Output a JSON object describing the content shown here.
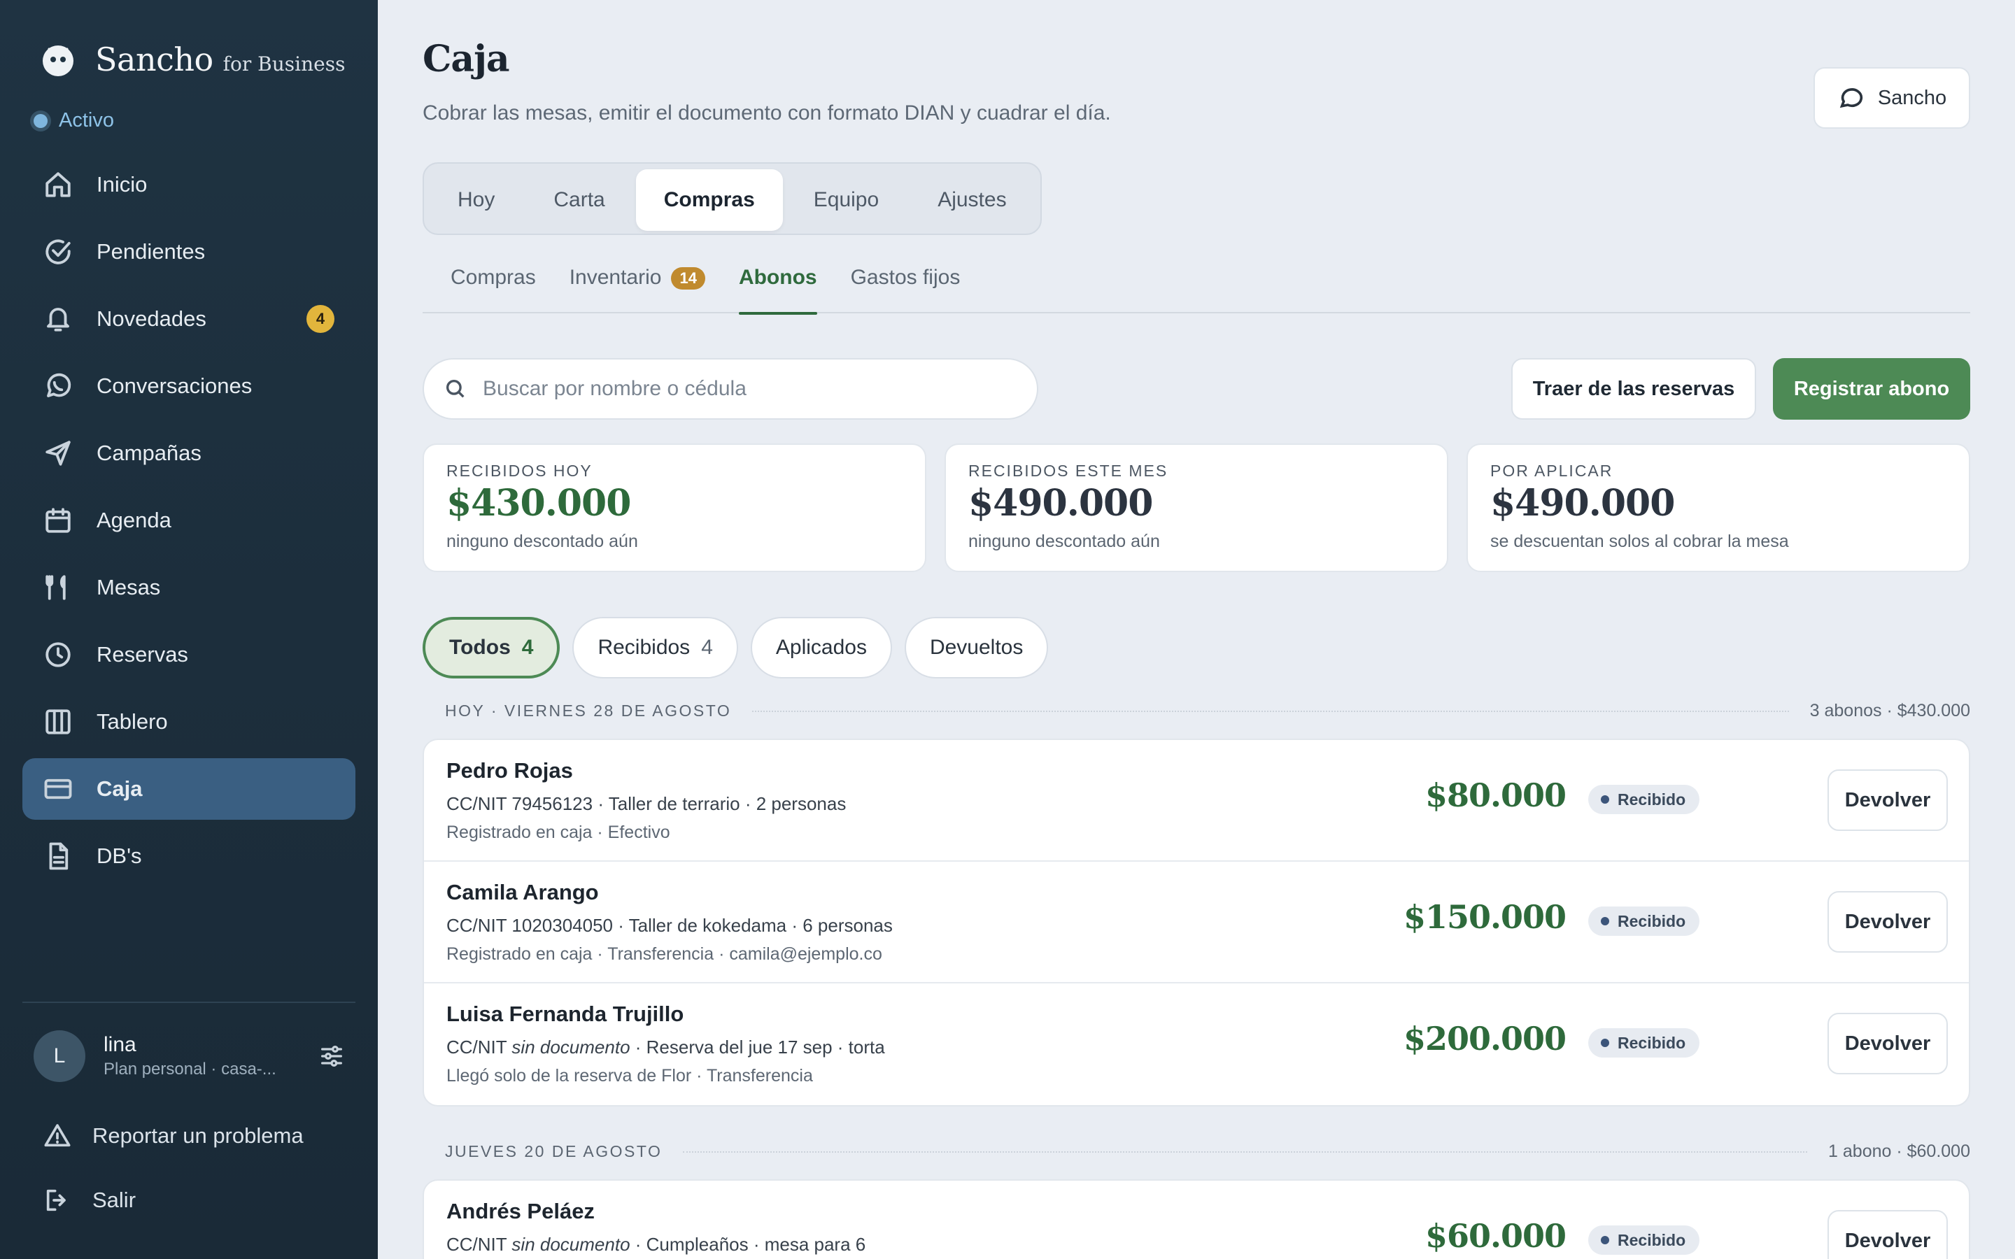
{
  "brand": {
    "name": "Sancho",
    "suffix": "for Business"
  },
  "status": {
    "label": "Activo"
  },
  "nav": [
    {
      "label": "Inicio",
      "icon": "home-icon"
    },
    {
      "label": "Pendientes",
      "icon": "check-circle-icon"
    },
    {
      "label": "Novedades",
      "icon": "bell-icon",
      "badge": "4"
    },
    {
      "label": "Conversaciones",
      "icon": "whatsapp-icon"
    },
    {
      "label": "Campañas",
      "icon": "send-icon"
    },
    {
      "label": "Agenda",
      "icon": "calendar-icon"
    },
    {
      "label": "Mesas",
      "icon": "utensils-icon"
    },
    {
      "label": "Reservas",
      "icon": "clock-icon"
    },
    {
      "label": "Tablero",
      "icon": "columns-icon"
    },
    {
      "label": "Caja",
      "icon": "credit-card-icon",
      "active": true
    },
    {
      "label": "DB's",
      "icon": "document-icon"
    }
  ],
  "user": {
    "initial": "L",
    "name": "lina",
    "plan": "Plan personal · casa-..."
  },
  "footer_links": {
    "report": "Reportar un problema",
    "logout": "Salir"
  },
  "page": {
    "title": "Caja",
    "subtitle": "Cobrar las mesas, emitir el documento con formato DIAN y cuadrar el día.",
    "assistant_button": "Sancho"
  },
  "segments": [
    "Hoy",
    "Carta",
    "Compras",
    "Equipo",
    "Ajustes"
  ],
  "segment_active": "Compras",
  "subtabs": {
    "compras": "Compras",
    "inventario": "Inventario",
    "inventario_badge": "14",
    "abonos": "Abonos",
    "gastos": "Gastos fijos"
  },
  "search": {
    "placeholder": "Buscar por nombre o cédula",
    "value": ""
  },
  "actions": {
    "secondary": "Traer de las reservas",
    "primary": "Registrar abono"
  },
  "stats": [
    {
      "label": "RECIBIDOS HOY",
      "value": "$430.000",
      "note": "ninguno descontado aún"
    },
    {
      "label": "RECIBIDOS ESTE MES",
      "value": "$490.000",
      "note": "ninguno descontado aún"
    },
    {
      "label": "POR APLICAR",
      "value": "$490.000",
      "note": "se descuentan solos al cobrar la mesa"
    }
  ],
  "filters": [
    {
      "label": "Todos",
      "count": "4",
      "active": true
    },
    {
      "label": "Recibidos",
      "count": "4"
    },
    {
      "label": "Aplicados",
      "count": ""
    },
    {
      "label": "Devueltos",
      "count": ""
    }
  ],
  "groups": [
    {
      "label": "HOY · VIERNES 28 DE AGOSTO",
      "summary": "3 abonos · $430.000",
      "rows": [
        {
          "name": "Pedro Rojas",
          "doc": "79456123",
          "doc_missing": false,
          "details": " · Taller de terrario · 2 personas",
          "sub": "Registrado en caja · Efectivo",
          "amount": "$80.000",
          "status": "Recibido",
          "action": "Devolver"
        },
        {
          "name": "Camila Arango",
          "doc": "1020304050",
          "doc_missing": false,
          "details": " · Taller de kokedama · 6 personas",
          "sub": "Registrado en caja · Transferencia · camila@ejemplo.co",
          "amount": "$150.000",
          "status": "Recibido",
          "action": "Devolver"
        },
        {
          "name": "Luisa Fernanda Trujillo",
          "doc": "sin documento",
          "doc_missing": true,
          "details": " · Reserva del jue 17 sep · torta",
          "sub": "Llegó solo de la reserva de Flor · Transferencia",
          "amount": "$200.000",
          "status": "Recibido",
          "action": "Devolver"
        }
      ]
    },
    {
      "label": "JUEVES 20 DE AGOSTO",
      "summary": "1 abono · $60.000",
      "rows": [
        {
          "name": "Andrés Peláez",
          "doc": "sin documento",
          "doc_missing": true,
          "details": " · Cumpleaños · mesa para 6",
          "sub": "",
          "amount": "$60.000",
          "status": "Recibido",
          "action": "Devolver"
        }
      ]
    }
  ],
  "doc_prefix": "CC/NIT ",
  "colors": {
    "sidebar": "#1f3342",
    "active_nav": "#3a5f82",
    "accent_green": "#4d8a55",
    "amount_green": "#2e6a3b",
    "badge_gold": "#e2b53c"
  }
}
